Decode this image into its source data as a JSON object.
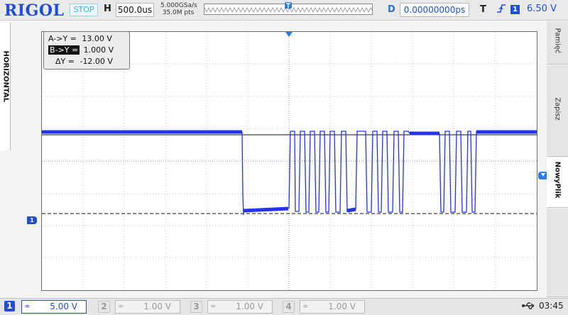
{
  "header": {
    "brand": "RIGOL",
    "run_state": "STOP",
    "horizontal_label": "H",
    "timebase": "500.0us",
    "sample_rate": "5.000GSa/s",
    "memory_depth": "35.0M pts",
    "delay_label": "D",
    "delay": "0.00000000ps",
    "trigger_label": "T",
    "trigger_channel": "1",
    "trigger_level": "6.50 V"
  },
  "left_tab": {
    "label": "HORIZONTAL"
  },
  "right_menu": {
    "items": [
      {
        "label": "Pamięć",
        "active": false
      },
      {
        "label": "Zapisz",
        "active": false
      },
      {
        "label": "NowyPlik",
        "active": true
      }
    ]
  },
  "cursors": {
    "a_y_label": "A->Y =",
    "a_y_value": "13.00 V",
    "b_y_label": "B->Y =",
    "b_y_value": "1.000 V",
    "delta_label": "ΔY =",
    "delta_value": "-12.00 V"
  },
  "channel_marker": "1",
  "channels": [
    {
      "num": "1",
      "scale": "5.00 V",
      "active": true
    },
    {
      "num": "2",
      "scale": "1.00 V",
      "active": false
    },
    {
      "num": "3",
      "scale": "1.00 V",
      "active": false
    },
    {
      "num": "4",
      "scale": "1.00 V",
      "active": false
    }
  ],
  "status": {
    "clock": "03:45"
  },
  "colors": {
    "brand": "#1f4ed8",
    "trace": "#2434e6",
    "stop": "#3ab0e8"
  }
}
